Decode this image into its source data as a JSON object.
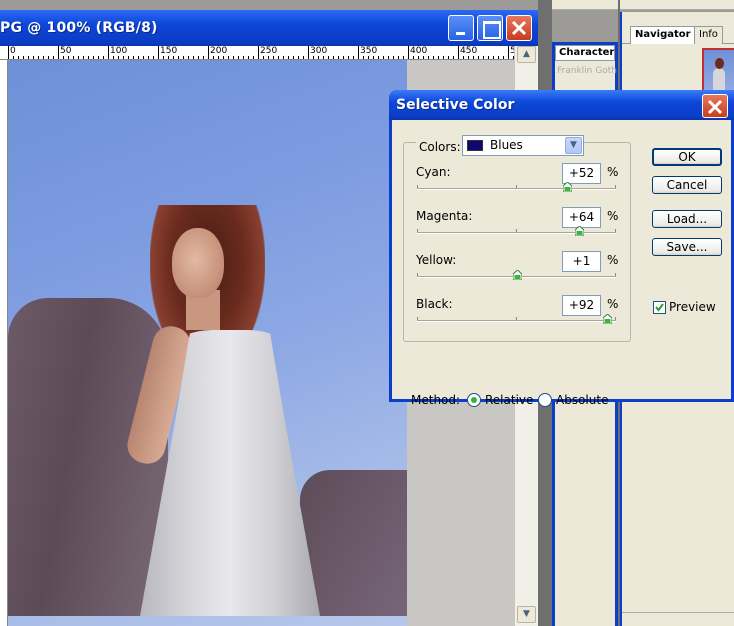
{
  "document": {
    "title": "PG @ 100% (RGB/8)",
    "ruler_labels": [
      "0",
      "50",
      "100",
      "150",
      "200",
      "250",
      "300",
      "350",
      "400",
      "450",
      "5"
    ]
  },
  "panels": {
    "character_tab": "Character",
    "character_font": "Franklin Goth",
    "navigator_tab": "Navigator",
    "info_tab": "Info"
  },
  "dialog": {
    "title": "Selective Color",
    "colors_label": "Colors:",
    "colors_value": "Blues",
    "colors_swatch": "#0c0a72",
    "sliders": [
      {
        "label": "Cyan:",
        "value": "+52",
        "percent": 52
      },
      {
        "label": "Magenta:",
        "value": "+64",
        "percent": 64
      },
      {
        "label": "Yellow:",
        "value": "+1",
        "percent": 1
      },
      {
        "label": "Black:",
        "value": "+92",
        "percent": 92
      }
    ],
    "percent_sign": "%",
    "buttons": {
      "ok": "OK",
      "cancel": "Cancel",
      "load": "Load...",
      "save": "Save..."
    },
    "preview_label": "Preview",
    "preview_checked": true,
    "method_label": "Method:",
    "method_options": [
      "Relative",
      "Absolute"
    ],
    "method_selected": "Relative"
  },
  "colors": {
    "titlebar": "#0b3fc9",
    "close": "#c63d1f",
    "dialog_bg": "#ece9d8"
  }
}
